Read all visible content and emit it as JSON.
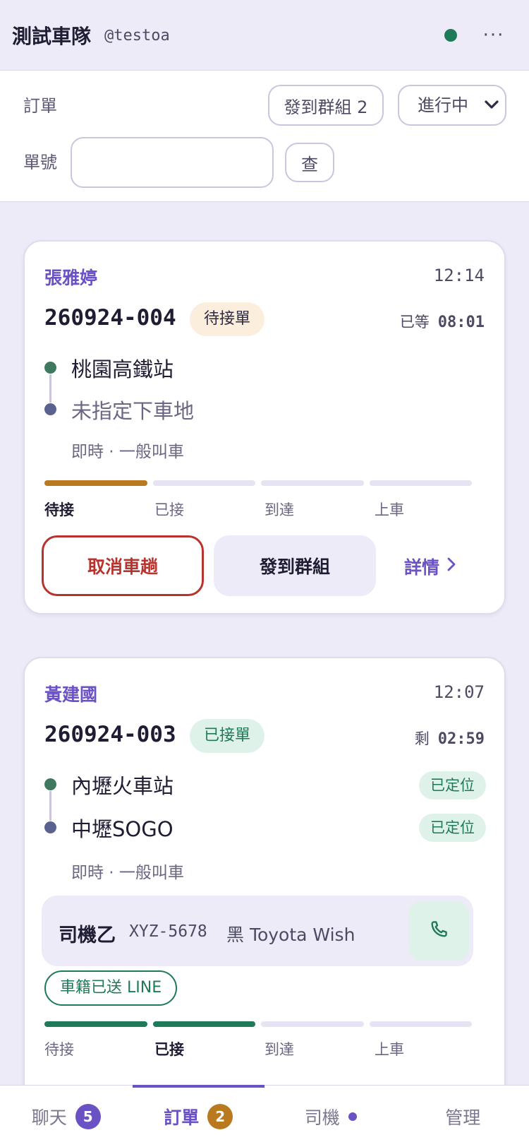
{
  "header": {
    "team_name": "測試車隊",
    "handle": "@testoa",
    "status_color": "#1f7a57",
    "more_label": "···"
  },
  "toolbar": {
    "orders_label": "訂單",
    "send_group_label": "發到群組 2",
    "filter_value": "進行中",
    "order_no_label": "單號",
    "order_no_value": "",
    "search_label": "查"
  },
  "orders": [
    {
      "customer": "張雅婷",
      "time": "12:14",
      "order_no": "260924-004",
      "status": "待接單",
      "timer_label": "已等",
      "timer_value": "08:01",
      "pickup": "桃園高鐵站",
      "dropoff": "未指定下車地",
      "ride_type": "即時 · 一般叫車",
      "progress_steps": [
        "待接",
        "已接",
        "到達",
        "上車"
      ],
      "current_step": 0,
      "actions": {
        "cancel": "取消車趟",
        "send_group": "發到群組",
        "details": "詳情"
      }
    },
    {
      "customer": "黃建國",
      "time": "12:07",
      "order_no": "260924-003",
      "status": "已接單",
      "timer_label": "剩",
      "timer_value": "02:59",
      "pickup": "內壢火車站",
      "pickup_badge": "已定位",
      "dropoff": "中壢SOGO",
      "dropoff_badge": "已定位",
      "ride_type": "即時 · 一般叫車",
      "driver": {
        "name": "司機乙",
        "plate": "XYZ-5678",
        "car": "黑 Toyota Wish"
      },
      "line_status": "車籍已送 LINE",
      "progress_steps": [
        "待接",
        "已接",
        "到達",
        "上車"
      ],
      "current_step": 1
    }
  ],
  "bottom_nav": [
    {
      "label": "聊天",
      "badge": "5",
      "badge_color": "#6a52c4"
    },
    {
      "label": "訂單",
      "badge": "2",
      "badge_color": "#b8791f",
      "active": true
    },
    {
      "label": "司機",
      "dot": true
    },
    {
      "label": "管理"
    }
  ],
  "colors": {
    "accent": "#6a52c4",
    "pending_progress": "#b8791f",
    "accepted_progress": "#1f7a57",
    "danger": "#b8332e"
  }
}
